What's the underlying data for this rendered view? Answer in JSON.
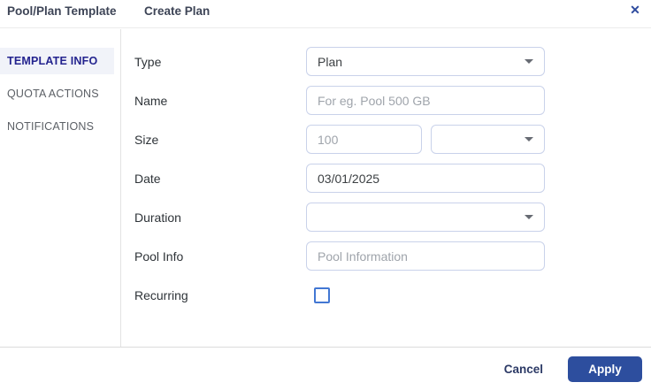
{
  "header": {
    "title": "Pool/Plan Template",
    "subtitle": "Create Plan",
    "close_icon": "✕"
  },
  "sidebar": {
    "items": [
      {
        "label": "TEMPLATE INFO",
        "active": true
      },
      {
        "label": "QUOTA ACTIONS",
        "active": false
      },
      {
        "label": "NOTIFICATIONS",
        "active": false
      }
    ]
  },
  "form": {
    "type": {
      "label": "Type",
      "value": "Plan"
    },
    "name": {
      "label": "Name",
      "value": "",
      "placeholder": "For eg. Pool 500 GB"
    },
    "size": {
      "label": "Size",
      "value": "",
      "placeholder": "100",
      "unit_value": ""
    },
    "date": {
      "label": "Date",
      "value": "03/01/2025"
    },
    "duration": {
      "label": "Duration",
      "value": ""
    },
    "pool_info": {
      "label": "Pool Info",
      "value": "",
      "placeholder": "Pool Information"
    },
    "recurring": {
      "label": "Recurring",
      "checked": false
    }
  },
  "footer": {
    "cancel_label": "Cancel",
    "apply_label": "Apply"
  },
  "colors": {
    "accent": "#2d4e9e",
    "active_tab_text": "#24248f",
    "input_border": "#c9d2ea",
    "checkbox_border": "#4277d3"
  }
}
